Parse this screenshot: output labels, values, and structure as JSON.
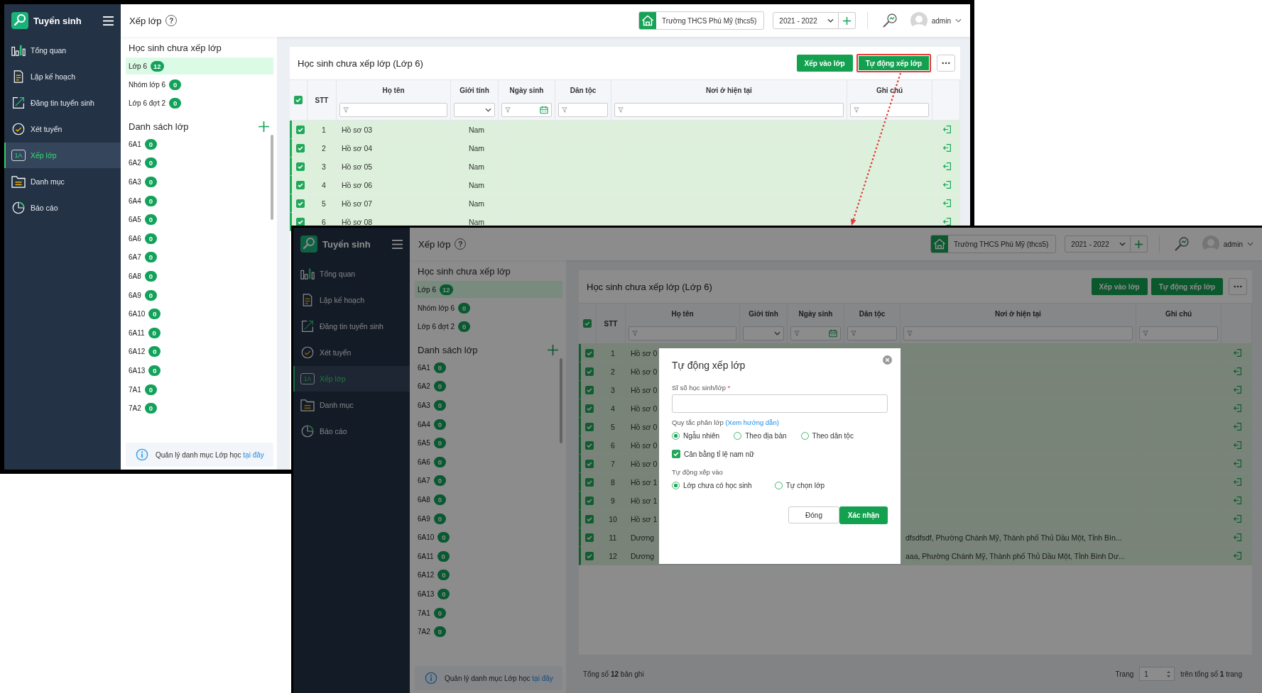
{
  "windows": [
    {
      "sidebar": {
        "title": "Tuyển sinh",
        "items": [
          {
            "label": "Tổng quan",
            "selected": false
          },
          {
            "label": "Lập kế hoạch",
            "selected": false
          },
          {
            "label": "Đăng tin tuyển sinh",
            "selected": false
          },
          {
            "label": "Xét tuyển",
            "selected": false
          },
          {
            "label": "Xếp lớp",
            "icon_text": "1A",
            "selected": true
          },
          {
            "label": "Danh mục",
            "selected": false
          },
          {
            "label": "Báo cáo",
            "selected": false
          }
        ]
      },
      "header": {
        "title": "Xếp lớp",
        "help": "?",
        "school": "Trường THCS Phú Mỹ (thcs5)",
        "year": "2021 - 2022",
        "user": "admin"
      },
      "pending": {
        "title": "Học sinh chưa xếp lớp",
        "groups": [
          {
            "label": "Lớp 6",
            "count": "12",
            "selected": true
          },
          {
            "label": "Nhóm lớp 6",
            "count": "0",
            "selected": false
          },
          {
            "label": "Lớp 6 đợt 2",
            "count": "0",
            "selected": false
          }
        ]
      },
      "classes": {
        "title": "Danh sách lớp",
        "items": [
          {
            "label": "6A1",
            "count": "0"
          },
          {
            "label": "6A2",
            "count": "0"
          },
          {
            "label": "6A3",
            "count": "0"
          },
          {
            "label": "6A4",
            "count": "0"
          },
          {
            "label": "6A5",
            "count": "0"
          },
          {
            "label": "6A6",
            "count": "0"
          },
          {
            "label": "6A7",
            "count": "0"
          },
          {
            "label": "6A8",
            "count": "0"
          },
          {
            "label": "6A9",
            "count": "0"
          },
          {
            "label": "6A10",
            "count": "0"
          },
          {
            "label": "6A11",
            "count": "0"
          },
          {
            "label": "6A12",
            "count": "0"
          },
          {
            "label": "6A13",
            "count": "0"
          },
          {
            "label": "7A1",
            "count": "0"
          },
          {
            "label": "7A2",
            "count": "0"
          }
        ]
      },
      "info": {
        "text": "Quản lý danh mục Lớp học",
        "link": "tại đây"
      },
      "card": {
        "title": "Học sinh chưa xếp lớp (Lớp 6)",
        "buttons": [
          {
            "label": "Xếp vào lớp",
            "highlighted": false
          },
          {
            "label": "Tự động xếp lớp",
            "highlighted": true
          }
        ],
        "columns": [
          "STT",
          "Họ tên",
          "Giới tính",
          "Ngày sinh",
          "Dân tộc",
          "Nơi ở hiện tại",
          "Ghi chú"
        ],
        "all_checked": true,
        "rows": [
          {
            "checked": true,
            "stt": "1",
            "name": "Hồ sơ 03",
            "gender": "Nam"
          },
          {
            "checked": true,
            "stt": "2",
            "name": "Hồ sơ 04",
            "gender": "Nam"
          },
          {
            "checked": true,
            "stt": "3",
            "name": "Hồ sơ 05",
            "gender": "Nam"
          },
          {
            "checked": true,
            "stt": "4",
            "name": "Hồ sơ 06",
            "gender": "Nam"
          },
          {
            "checked": true,
            "stt": "5",
            "name": "Hồ sơ 07",
            "gender": "Nam"
          },
          {
            "checked": true,
            "stt": "6",
            "name": "Hồ sơ 08",
            "gender": "Nam"
          }
        ]
      }
    },
    {
      "sidebar": {
        "title": "Tuyển sinh",
        "items": [
          {
            "label": "Tổng quan",
            "selected": false
          },
          {
            "label": "Lập kế hoạch",
            "selected": false
          },
          {
            "label": "Đăng tin tuyển sinh",
            "selected": false
          },
          {
            "label": "Xét tuyển",
            "selected": false
          },
          {
            "label": "Xếp lớp",
            "icon_text": "1A",
            "selected": true
          },
          {
            "label": "Danh mục",
            "selected": false
          },
          {
            "label": "Báo cáo",
            "selected": false
          }
        ]
      },
      "header": {
        "title": "Xếp lớp",
        "help": "?",
        "school": "Trường THCS Phú Mỹ (thcs5)",
        "year": "2021 - 2022",
        "user": "admin"
      },
      "pending": {
        "title": "Học sinh chưa xếp lớp",
        "groups": [
          {
            "label": "Lớp 6",
            "count": "12",
            "selected": true
          },
          {
            "label": "Nhóm lớp 6",
            "count": "0",
            "selected": false
          },
          {
            "label": "Lớp 6 đợt 2",
            "count": "0",
            "selected": false
          }
        ]
      },
      "classes": {
        "title": "Danh sách lớp",
        "items": [
          {
            "label": "6A1",
            "count": "0"
          },
          {
            "label": "6A2",
            "count": "0"
          },
          {
            "label": "6A3",
            "count": "0"
          },
          {
            "label": "6A4",
            "count": "0"
          },
          {
            "label": "6A5",
            "count": "0"
          },
          {
            "label": "6A6",
            "count": "0"
          },
          {
            "label": "6A7",
            "count": "0"
          },
          {
            "label": "6A8",
            "count": "0"
          },
          {
            "label": "6A9",
            "count": "0"
          },
          {
            "label": "6A10",
            "count": "0"
          },
          {
            "label": "6A11",
            "count": "0"
          },
          {
            "label": "6A12",
            "count": "0"
          },
          {
            "label": "6A13",
            "count": "0"
          },
          {
            "label": "7A1",
            "count": "0"
          },
          {
            "label": "7A2",
            "count": "0"
          }
        ]
      },
      "info": {
        "text": "Quản lý danh mục Lớp học",
        "link": "tại đây"
      },
      "card": {
        "title": "Học sinh chưa xếp lớp (Lớp 6)",
        "buttons": [
          {
            "label": "Xếp vào lớp",
            "highlighted": false
          },
          {
            "label": "Tự động xếp lớp",
            "highlighted": false
          }
        ],
        "columns": [
          "STT",
          "Họ tên",
          "Giới tính",
          "Ngày sinh",
          "Dân tộc",
          "Nơi ở hiện tại",
          "Ghi chú"
        ],
        "all_checked": true,
        "rows": [
          {
            "checked": true,
            "stt": "1",
            "name": "Hồ sơ 0"
          },
          {
            "checked": true,
            "stt": "2",
            "name": "Hồ sơ 0"
          },
          {
            "checked": true,
            "stt": "3",
            "name": "Hồ sơ 0"
          },
          {
            "checked": true,
            "stt": "4",
            "name": "Hồ sơ 0"
          },
          {
            "checked": true,
            "stt": "5",
            "name": "Hồ sơ 0"
          },
          {
            "checked": true,
            "stt": "6",
            "name": "Hồ sơ 0"
          },
          {
            "checked": true,
            "stt": "7",
            "name": "Hồ sơ 0"
          },
          {
            "checked": true,
            "stt": "8",
            "name": "Hồ sơ 1"
          },
          {
            "checked": true,
            "stt": "9",
            "name": "Hồ sơ 1"
          },
          {
            "checked": true,
            "stt": "10",
            "name": "Hồ sơ 1"
          },
          {
            "checked": true,
            "stt": "11",
            "name": "Dương",
            "address": "dfsdfsdf, Phường Chánh Mỹ, Thành phố Thủ Dầu Một, Tỉnh Bìn..."
          },
          {
            "checked": true,
            "stt": "12",
            "name": "Dương",
            "address": "aaa, Phường Chánh Mỹ, Thành phố Thủ Dầu Một, Tỉnh Bình Dư..."
          }
        ]
      },
      "footer": {
        "total": "Tổng số **12** bản ghi",
        "page_label": "Trang",
        "page": "1",
        "of": "trên tổng số **1** trang"
      },
      "dialog": {
        "title": "Tự động xếp lớp",
        "size_label": "Sĩ số học sinh/lớp",
        "required": "*",
        "rule_label": "Quy tắc phân lớp",
        "rule_link": "(Xem hướng dẫn)",
        "rules": [
          {
            "label": "Ngẫu nhiên",
            "selected": true
          },
          {
            "label": "Theo địa bàn",
            "selected": false
          },
          {
            "label": "Theo dân tộc",
            "selected": false
          }
        ],
        "balance": {
          "label": "Cân bằng tỉ lệ nam nữ",
          "checked": true
        },
        "target_label": "Tự động xếp vào",
        "targets": [
          {
            "label": "Lớp chưa có học sinh",
            "selected": true
          },
          {
            "label": "Tự chọn lớp",
            "selected": false
          }
        ],
        "buttons": {
          "cancel": "Đóng",
          "confirm": "Xác nhận"
        }
      }
    }
  ]
}
